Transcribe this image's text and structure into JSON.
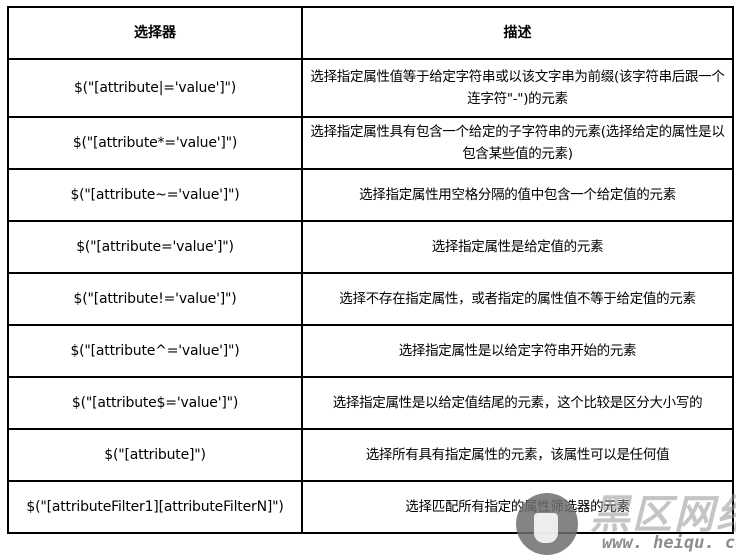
{
  "table": {
    "headers": {
      "selector": "选择器",
      "description": "描述"
    },
    "rows": [
      {
        "selector": "$(\"[attribute|='value']\")",
        "description": "选择指定属性值等于给定字符串或以该文字串为前缀(该字符串后跟一个连字符\"-\")的元素"
      },
      {
        "selector": "$(\"[attribute*='value']\")",
        "description": "选择指定属性具有包含一个给定的子字符串的元素(选择给定的属性是以包含某些值的元素)"
      },
      {
        "selector": "$(\"[attribute~='value']\")",
        "description": "选择指定属性用空格分隔的值中包含一个给定值的元素"
      },
      {
        "selector": "$(\"[attribute='value']\")",
        "description": "选择指定属性是给定值的元素"
      },
      {
        "selector": "$(\"[attribute!='value']\")",
        "description": "选择不存在指定属性，或者指定的属性值不等于给定值的元素"
      },
      {
        "selector": "$(\"[attribute^='value']\")",
        "description": "选择指定属性是以给定字符串开始的元素"
      },
      {
        "selector": "$(\"[attribute$='value']\")",
        "description": "选择指定属性是以给定值结尾的元素，这个比较是区分大小写的"
      },
      {
        "selector": "$(\"[attribute]\")",
        "description": "选择所有具有指定属性的元素，该属性可以是任何值"
      },
      {
        "selector": "$(\"[attributeFilter1][attributeFilterN]\")",
        "description": "选择匹配所有指定的属性筛选器的元素"
      }
    ]
  },
  "watermark": {
    "icon": "heiqu-logo-icon",
    "brand": "黑区网络",
    "url": "www. heiqu. com"
  }
}
